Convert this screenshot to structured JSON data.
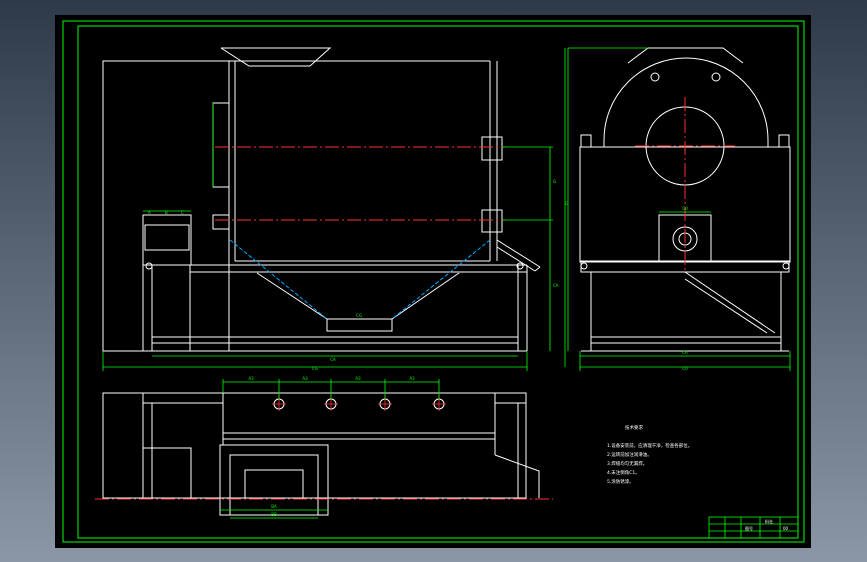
{
  "colors": {
    "background": "#000000",
    "frame": "#00ff00",
    "outline": "#ffffff",
    "centerline": "#ff3030",
    "hidden": "#00aaff"
  },
  "dimensions": {
    "front_width": "CA",
    "front_overall": "CG",
    "vertical_1": "G",
    "vertical_2": "CA",
    "left_small_1": "A",
    "left_small_2": "B",
    "left_small_3": "C",
    "trough_bottom": "CG",
    "side_width": "CA",
    "side_overall": "C0",
    "side_box": "G0",
    "side_vert": "G",
    "hole_pitch": [
      "A3",
      "A3",
      "A3",
      "A3"
    ],
    "plan_box_1": "BA",
    "plan_box_2": "BB"
  },
  "notes": {
    "title": "技术要求",
    "lines": [
      "1.设备安装前，应清理干净，检查各部位。",
      "2.运转前加注润滑油。",
      "3.焊缝均匀无漏焊。",
      "4.未注倒角C1。",
      "5.涂防锈漆。"
    ]
  },
  "title_block": {
    "name": "料仓",
    "code": "00",
    "label": "图号"
  }
}
